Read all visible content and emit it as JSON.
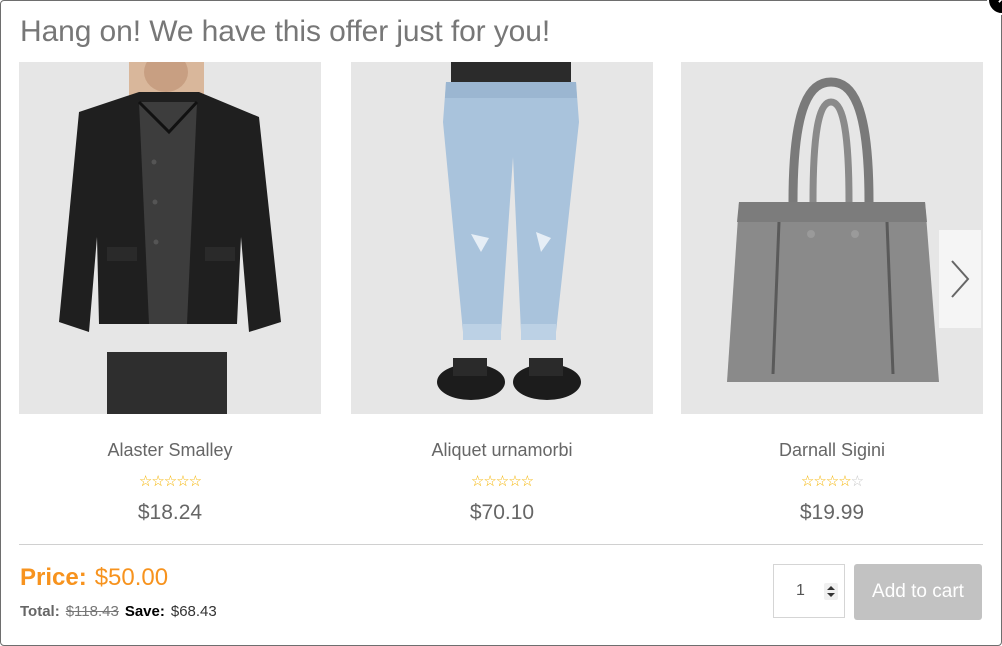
{
  "modal": {
    "title": "Hang on! We have this offer just for you!",
    "close_icon": "close-icon"
  },
  "products": [
    {
      "name": "Alaster Smalley",
      "rating": 5,
      "rating_max": 5,
      "price": "$18.24",
      "image": "leather-jacket-image"
    },
    {
      "name": "Aliquet urnamorbi",
      "rating": 5,
      "rating_max": 5,
      "price": "$70.10",
      "image": "jeans-image"
    },
    {
      "name": "Darnall Sigini",
      "rating": 4,
      "rating_max": 5,
      "price": "$19.99",
      "image": "tote-bag-image"
    }
  ],
  "carousel": {
    "next_icon": "chevron-right-icon"
  },
  "summary": {
    "price_label": "Price:",
    "price_value": "$50.00",
    "total_label": "Total:",
    "total_old": "$118.43",
    "save_label": "Save:",
    "save_value": "$68.43"
  },
  "cart": {
    "quantity": "1",
    "add_label": "Add to cart"
  },
  "colors": {
    "accent": "#f7931e",
    "star": "#f5b400",
    "button_disabled": "#c2c2c2"
  }
}
